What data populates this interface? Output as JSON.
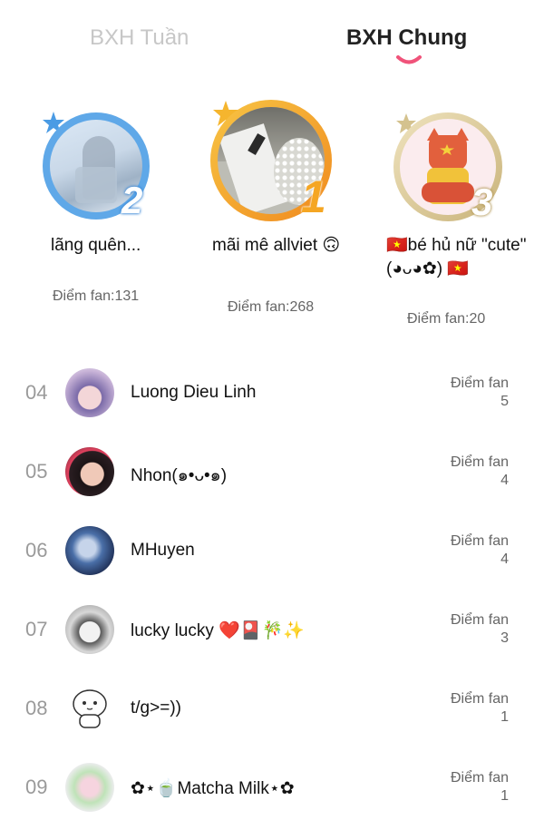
{
  "tabs": {
    "week": "BXH Tuần",
    "general": "BXH Chung"
  },
  "colors": {
    "accent": "#f0537a",
    "silver": "#5fa8e8",
    "gold": "#f2a01e",
    "bronze": "#d9c89a"
  },
  "podium": [
    {
      "rank": "2",
      "name": "lãng quên...",
      "score_text": "Điểm fan:131"
    },
    {
      "rank": "1",
      "name": "mãi mê allviet 🙃",
      "score_text": "Điểm fan:268"
    },
    {
      "rank": "3",
      "name": "🇻🇳bé hủ nữ \"cute\" (◕ᴗ◕✿) 🇻🇳",
      "score_text": "Điểm fan:20"
    }
  ],
  "list": [
    {
      "rank": "04",
      "name": "Luong Dieu Linh",
      "label": "Điểm fan",
      "value": "5"
    },
    {
      "rank": "05",
      "name": "Nhon(๑•ᴗ•๑)",
      "label": "Điểm fan",
      "value": "4"
    },
    {
      "rank": "06",
      "name": "MHuyen",
      "label": "Điểm fan",
      "value": "4"
    },
    {
      "rank": "07",
      "name": "lucky lucky ❤️🎴🎋✨",
      "label": "Điểm fan",
      "value": "3"
    },
    {
      "rank": "08",
      "name": "t/g>=))",
      "label": "Điểm fan",
      "value": "1"
    },
    {
      "rank": "09",
      "name": "✿⋆🍵Matcha Milk⋆✿",
      "label": "Điểm fan",
      "value": "1"
    }
  ]
}
